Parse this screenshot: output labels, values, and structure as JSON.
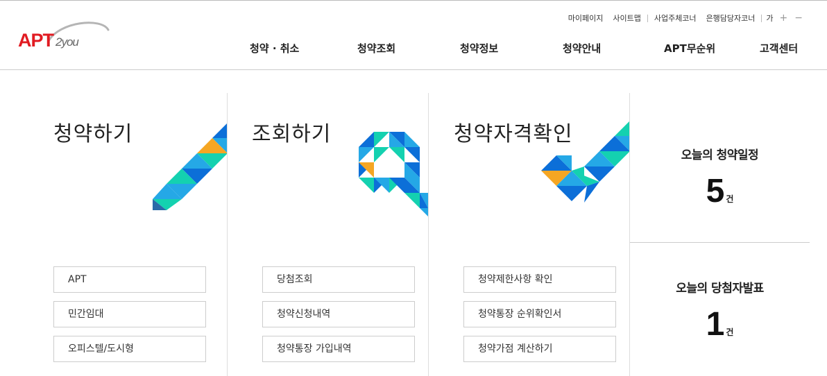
{
  "logo": {
    "brand": "APT",
    "suffix": "2you"
  },
  "util_menu": {
    "items": [
      "마이페이지",
      "사이트맵",
      "사업주체코너",
      "은행담당자코너"
    ],
    "font_label": "가",
    "font_plus": "+",
    "font_minus": "−"
  },
  "gnb": {
    "items": [
      "청약 · 취소",
      "청약조회",
      "청약정보",
      "청약안내",
      "APT무순위",
      "고객센터"
    ]
  },
  "columns": {
    "apply": {
      "title": "청약하기",
      "buttons": [
        "APT",
        "민간임대",
        "오피스텔/도시형"
      ]
    },
    "inquiry": {
      "title": "조회하기",
      "buttons": [
        "당첨조회",
        "청약신청내역",
        "청약통장 가입내역"
      ]
    },
    "qualification": {
      "title": "청약자격확인",
      "buttons": [
        "청약제한사항 확인",
        "청약통장 순위확인서",
        "청약가점 계산하기"
      ]
    }
  },
  "stats": {
    "schedule": {
      "title": "오늘의 청약일정",
      "count": "5",
      "unit": "건"
    },
    "winners": {
      "title": "오늘의 당첨자발표",
      "count": "1",
      "unit": "건"
    }
  },
  "colors": {
    "brand_red": "#e11b22",
    "blue": "#0c6fd8",
    "sky": "#25a8e6",
    "teal": "#14d1b0",
    "orange": "#f5a623"
  }
}
